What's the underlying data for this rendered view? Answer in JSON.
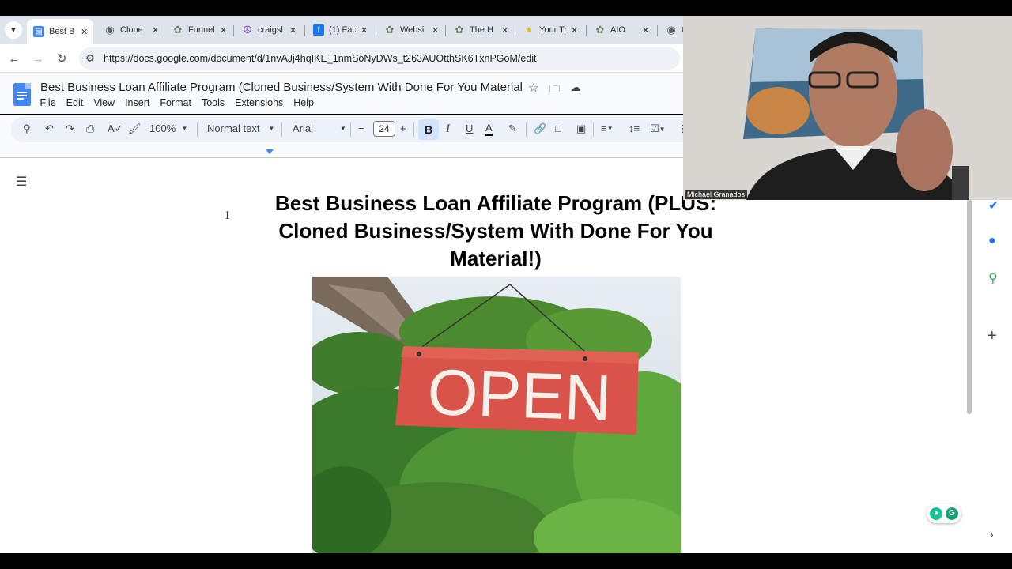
{
  "browser": {
    "tabs": [
      {
        "label": "Best B",
        "icon": "google-docs-icon",
        "color": "#4285f4",
        "active": true
      },
      {
        "label": "Clone",
        "icon": "globe-icon",
        "color": "#5f6368",
        "active": false
      },
      {
        "label": "Funnel",
        "icon": "tree-icon",
        "color": "#6b7b5e",
        "active": false
      },
      {
        "label": "craigsl",
        "icon": "peace-icon",
        "color": "#7b3fb0",
        "active": false
      },
      {
        "label": "(1) Fac",
        "icon": "facebook-icon",
        "color": "#1877f2",
        "active": false
      },
      {
        "label": "Websi",
        "icon": "tree-icon",
        "color": "#6b7b5e",
        "active": false
      },
      {
        "label": "The H",
        "icon": "tree-icon",
        "color": "#6b7b5e",
        "active": false
      },
      {
        "label": "Your Tr",
        "icon": "star-icon",
        "color": "#f4b400",
        "active": false
      },
      {
        "label": "AIO",
        "icon": "tree-icon",
        "color": "#6b7b5e",
        "active": false
      },
      {
        "label": "C",
        "icon": "globe-icon",
        "color": "#5f6368",
        "active": false
      }
    ],
    "url": "https://docs.google.com/document/d/1nvAJj4hqIKE_1nmSoNyDWs_t263AUOtthSK6TxnPGoM/edit"
  },
  "docs": {
    "title": "Best Business Loan Affiliate Program (Cloned Business/System With Done For You Material",
    "menu": [
      "File",
      "Edit",
      "View",
      "Insert",
      "Format",
      "Tools",
      "Extensions",
      "Help"
    ],
    "toolbar": {
      "zoom": "100%",
      "style": "Normal text",
      "font": "Arial",
      "font_size": "24",
      "bold": "B",
      "italic": "I",
      "underline": "U",
      "text_color": "A"
    },
    "heading_line1": "Best Business Loan Affiliate Program (PLUS:",
    "heading_line2": "Cloned Business/System With Done For You",
    "heading_line3": "Material!)",
    "image_sign_text": "OPEN"
  },
  "webcam": {
    "name": "Michael Granados"
  },
  "colors": {
    "accent_blue": "#4285f4",
    "sign_red": "#d9534a",
    "grammarly_green": "#15c39a"
  }
}
